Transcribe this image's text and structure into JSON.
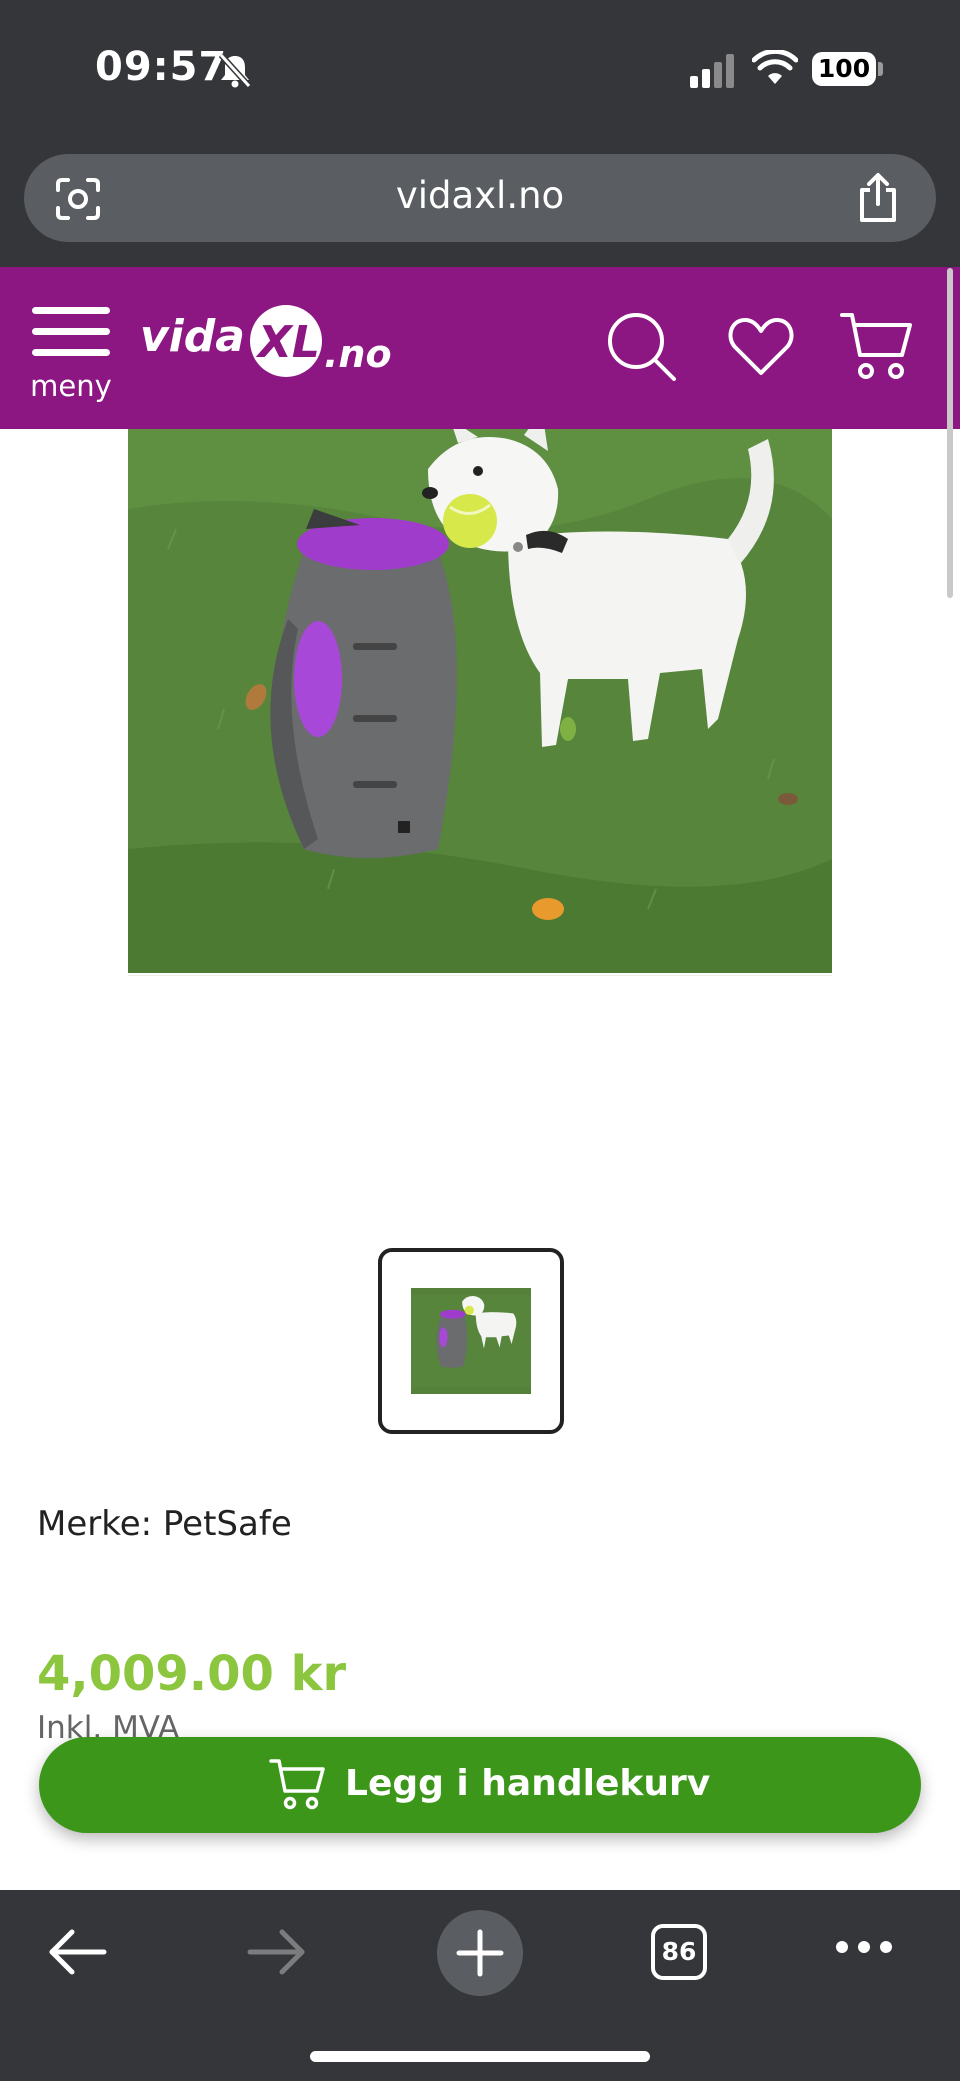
{
  "status_bar": {
    "time": "09:57",
    "battery": "100"
  },
  "browser": {
    "url": "vidaxl.no",
    "tab_count": "86"
  },
  "site_header": {
    "menu_label": "meny",
    "logo_text": "vidaXL.no",
    "brand_color": "#8d1782"
  },
  "product": {
    "brand_line": "Merke: PetSafe",
    "price": "4,009.00 kr",
    "vat_note": "Inkl. MVA",
    "add_to_cart_label": "Legg i handlekurv",
    "price_color": "#8cc63e",
    "button_color": "#3c9619"
  },
  "icons": {
    "status": [
      "bell-slash-icon",
      "signal-icon",
      "wifi-icon",
      "battery-icon"
    ],
    "url_bar": [
      "lens-icon",
      "share-icon"
    ],
    "header": [
      "hamburger-menu-icon",
      "search-icon",
      "heart-icon",
      "cart-icon"
    ],
    "toolbar": [
      "arrow-left-icon",
      "arrow-right-icon",
      "plus-icon",
      "tabs-icon",
      "more-icon"
    ]
  }
}
